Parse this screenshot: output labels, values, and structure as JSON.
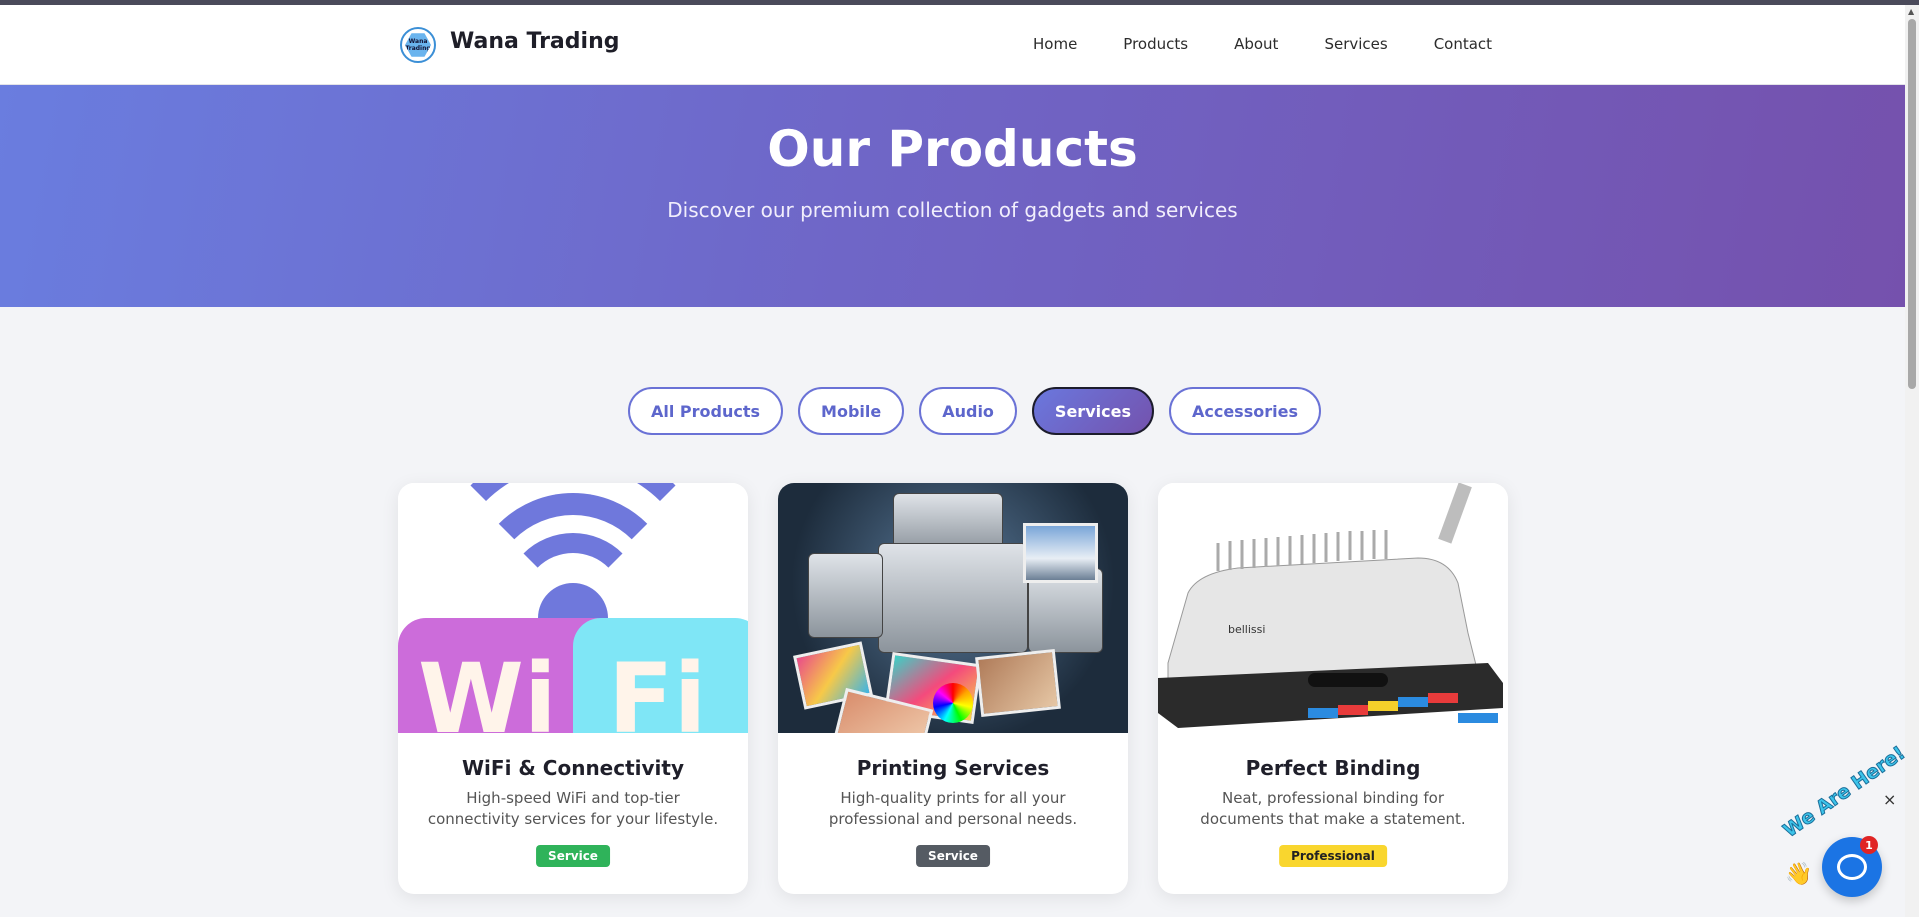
{
  "header": {
    "brand": "Wana Trading",
    "logo_text": "Wana Trading",
    "nav": [
      "Home",
      "Products",
      "About",
      "Services",
      "Contact"
    ]
  },
  "hero": {
    "title": "Our Products",
    "subtitle": "Discover our premium collection of gadgets and services"
  },
  "filters": {
    "items": [
      "All Products",
      "Mobile",
      "Audio",
      "Services",
      "Accessories"
    ],
    "active": "Services"
  },
  "cards": [
    {
      "title": "WiFi & Connectivity",
      "desc": "High-speed WiFi and top-tier connectivity services for your lifestyle.",
      "badge": "Service",
      "image_text_left": "Wi",
      "image_text_right": "Fi"
    },
    {
      "title": "Printing Services",
      "desc": "High-quality prints for all your professional and personal needs.",
      "badge": "Service"
    },
    {
      "title": "Perfect Binding",
      "desc": "Neat, professional binding for documents that make a statement.",
      "badge": "Professional",
      "image_brand": "bellissi"
    }
  ],
  "chat": {
    "label": "We Are Here!",
    "unread": "1",
    "close": "×"
  },
  "colors": {
    "accent": "#6a72d6",
    "hero_start": "#6a7ddf",
    "hero_end": "#7551ad",
    "badge_service_green": "#2fb35a",
    "badge_service_gray": "#555b63",
    "badge_professional": "#f9d62e",
    "chat": "#1b74e4"
  }
}
